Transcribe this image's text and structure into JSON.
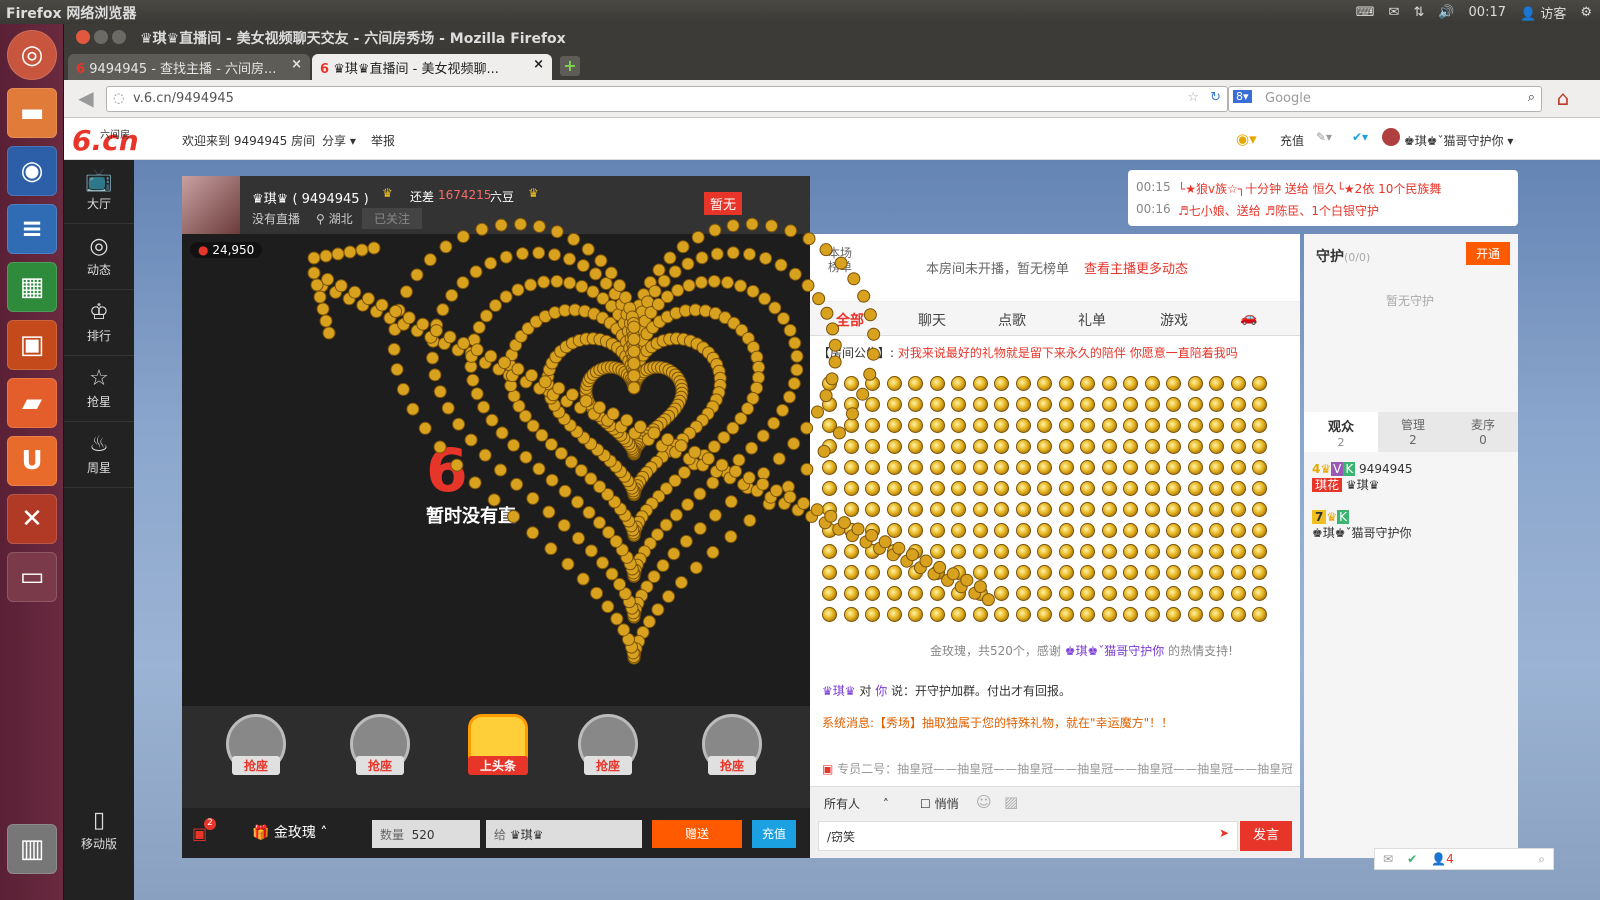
{
  "os": {
    "title": "Firefox 网络浏览器",
    "time": "00:17",
    "user": "访客"
  },
  "window": {
    "title": "♛琪♛直播间 - 美女视频聊天交友 - 六间房秀场 - Mozilla Firefox"
  },
  "tabs": [
    {
      "label": "9494945 - 查找主播 - 六间房..."
    },
    {
      "label": "♛琪♛直播间 - 美女视频聊..."
    }
  ],
  "nav": {
    "url": "v.6.cn/9494945",
    "search_placeholder": "Google"
  },
  "site": {
    "logo": "6.cn",
    "logo_small": "六间房",
    "welcome": "欢迎来到 9494945 房间",
    "share": "分享",
    "report": "举报",
    "recharge": "充值",
    "username": "♚琪♚ˇ猫哥守护你"
  },
  "leftnav": [
    {
      "label": "大厅",
      "icon": "tv-icon"
    },
    {
      "label": "动态",
      "icon": "compass-icon"
    },
    {
      "label": "排行",
      "icon": "crown-icon"
    },
    {
      "label": "抢星",
      "icon": "star-icon"
    },
    {
      "label": "周星",
      "icon": "cake-icon"
    }
  ],
  "mobile": "移动版",
  "anchor": {
    "name": "♛琪♛ ( 9494945 )",
    "diff_prefix": "还差",
    "diff_value": "1674215",
    "diff_unit": "六豆",
    "status": "没有直播",
    "location": "湖北",
    "follow": "已关注",
    "flag": "暂无"
  },
  "video": {
    "coins": "24,950",
    "offline_text": "暂时没有直"
  },
  "seats": [
    {
      "label": "抢座"
    },
    {
      "label": "抢座"
    },
    {
      "label": "上头条"
    },
    {
      "label": "抢座"
    },
    {
      "label": "抢座"
    }
  ],
  "gift": {
    "name": "金玫瑰",
    "qty_label": "数量",
    "qty": "520",
    "to_label": "给",
    "to": "♛琪♛",
    "send": "赠送",
    "recharge": "充值",
    "badge": "2"
  },
  "notice": [
    {
      "time": "00:15",
      "text": "└★狼v族☆┐十分钟 送给 恒久└★2依 10个民族舞"
    },
    {
      "time": "00:16",
      "text": "♬七小娘、送给 ♬陈臣、1个白银守护"
    }
  ],
  "rank": {
    "label1": "本场",
    "label2": "榜单",
    "msg": "本房间未开播，暂无榜单",
    "link": "查看主播更多动态"
  },
  "chattabs": [
    "全部",
    "聊天",
    "点歌",
    "礼单",
    "游戏"
  ],
  "chat": {
    "announce_label": "【房间公告】:",
    "announce": "对我来说最好的礼物就是留下来永久的陪伴 你愿意一直陪着我吗",
    "gift_msg_a": "金玫瑰，共520个，感谢",
    "gift_msg_user": "♚琪♚ˇ猫哥守护你",
    "gift_msg_b": "的热情支持!",
    "msg1_user": "♛琪♛",
    "msg1_mid": "对",
    "msg1_to": "你",
    "msg1_text": "说：开守护加群。付出才有回报。",
    "system": "系统消息:【秀场】抽取独属于您的特殊礼物，就在\"幸运魔方\"！！",
    "scroll": "专员二号：抽皇冠——抽皇冠——抽皇冠——抽皇冠——抽皇冠——抽皇冠——抽皇冠"
  },
  "input": {
    "target": "所有人",
    "whisper": "悄悄",
    "value": "/窃笑",
    "send": "发言"
  },
  "guard": {
    "title": "守护",
    "count": "(0/0)",
    "open": "开通",
    "empty": "暂无守护"
  },
  "audience": {
    "tabs": [
      {
        "label": "观众",
        "count": "2"
      },
      {
        "label": "管理",
        "count": "2"
      },
      {
        "label": "麦序",
        "count": "0"
      }
    ],
    "users": [
      {
        "level": "4",
        "name": "9494945",
        "sub": "♛琪♛",
        "tag": "琪花"
      },
      {
        "level": "7",
        "name": "♚琪♚ˇ猫哥守护你"
      }
    ]
  },
  "status": {
    "count": "4"
  },
  "colors": {
    "accent": "#e8352a",
    "orange": "#ff6a00",
    "blue": "#1ba1e2"
  }
}
